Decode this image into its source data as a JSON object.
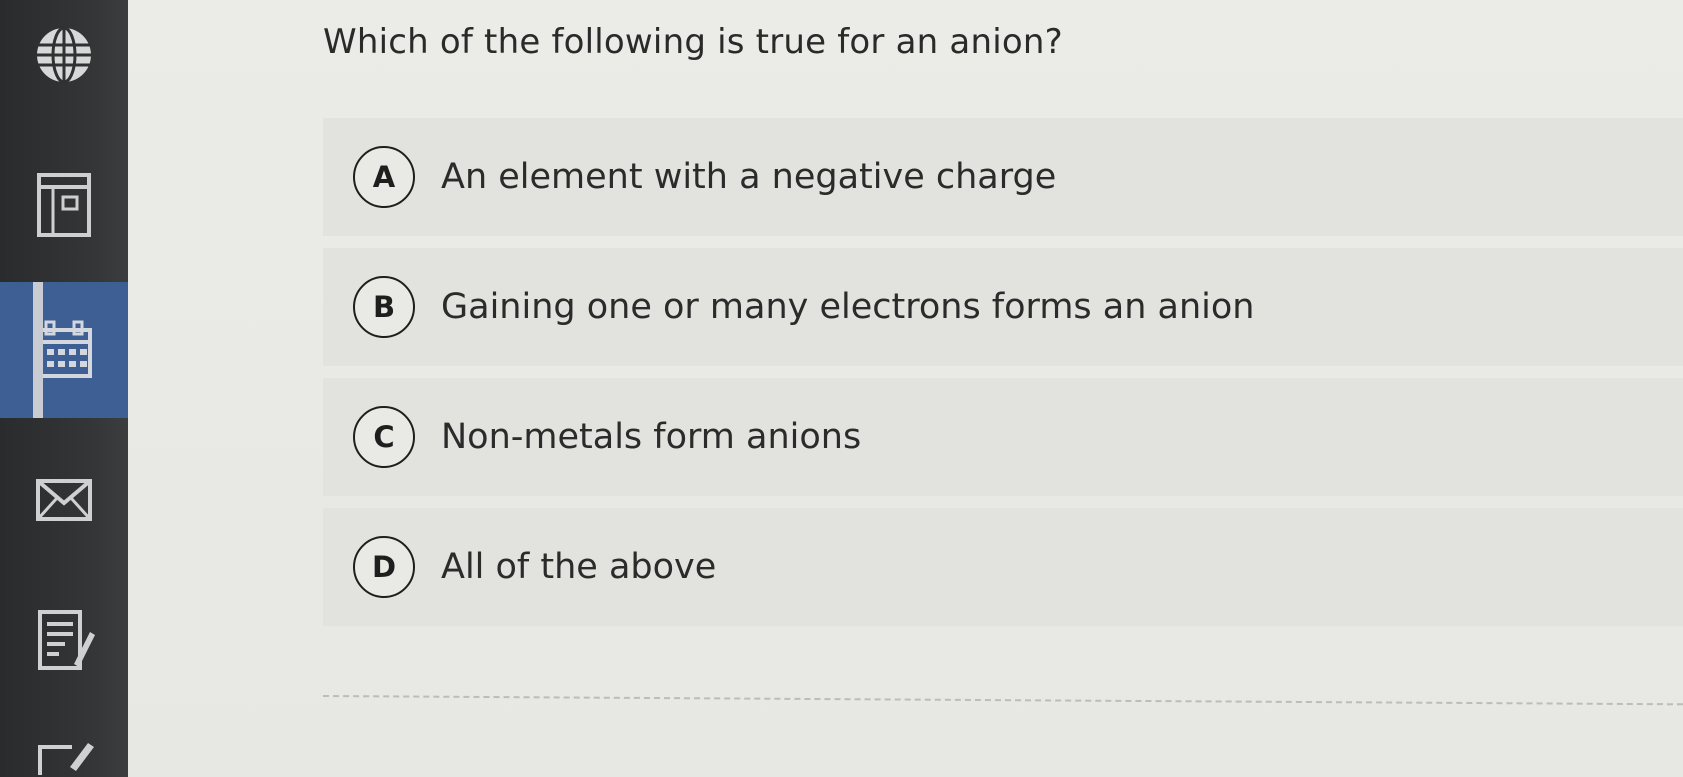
{
  "sidebar": {
    "items": [
      {
        "icon": "globe-icon"
      },
      {
        "icon": "window-icon"
      },
      {
        "icon": "calendar-icon",
        "active": true
      },
      {
        "icon": "mail-icon"
      },
      {
        "icon": "notes-edit-icon"
      },
      {
        "icon": "edit-icon"
      }
    ],
    "active_color": "#3d5f94"
  },
  "question": {
    "text": "Which of the following is true for an anion?"
  },
  "options": [
    {
      "letter": "A",
      "text": "An element with a negative charge"
    },
    {
      "letter": "B",
      "text": "Gaining one or many electrons forms an anion"
    },
    {
      "letter": "C",
      "text": "Non-metals form anions"
    },
    {
      "letter": "D",
      "text": "All of the above"
    }
  ]
}
